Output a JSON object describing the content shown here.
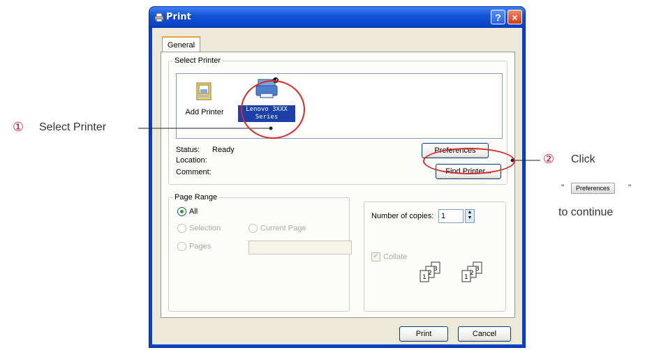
{
  "window": {
    "title": "Print",
    "help_label": "?",
    "close_label": "×"
  },
  "tabs": {
    "general": "General"
  },
  "select_printer": {
    "legend": "Select Printer",
    "items": [
      {
        "label": "Add Printer"
      },
      {
        "label": "Lenovo 3XXX Series"
      }
    ],
    "status_label": "Status:",
    "status_value": "Ready",
    "location_label": "Location:",
    "comment_label": "Comment:",
    "preferences_button": "Preferences",
    "find_printer_button": "Find Printer..."
  },
  "page_range": {
    "legend": "Page Range",
    "all_label": "All",
    "selection_label": "Selection",
    "current_page_label": "Current Page",
    "pages_label": "Pages"
  },
  "copies": {
    "number_label": "Number of copies:",
    "number_value": "1",
    "collate_label": "Collate"
  },
  "footer": {
    "print_button": "Print",
    "cancel_button": "Cancel"
  },
  "annotations": {
    "step1_number": "①",
    "step1_text": "Select Printer",
    "step2_number": "②",
    "step2_text": "Click",
    "quote_open": "\"",
    "quote_close": "\"",
    "preferences_chip": "Preferences",
    "continue_text": "to continue"
  },
  "colors": {
    "annotation_red": "#d42a2a",
    "title_blue": "#0a45c9"
  }
}
